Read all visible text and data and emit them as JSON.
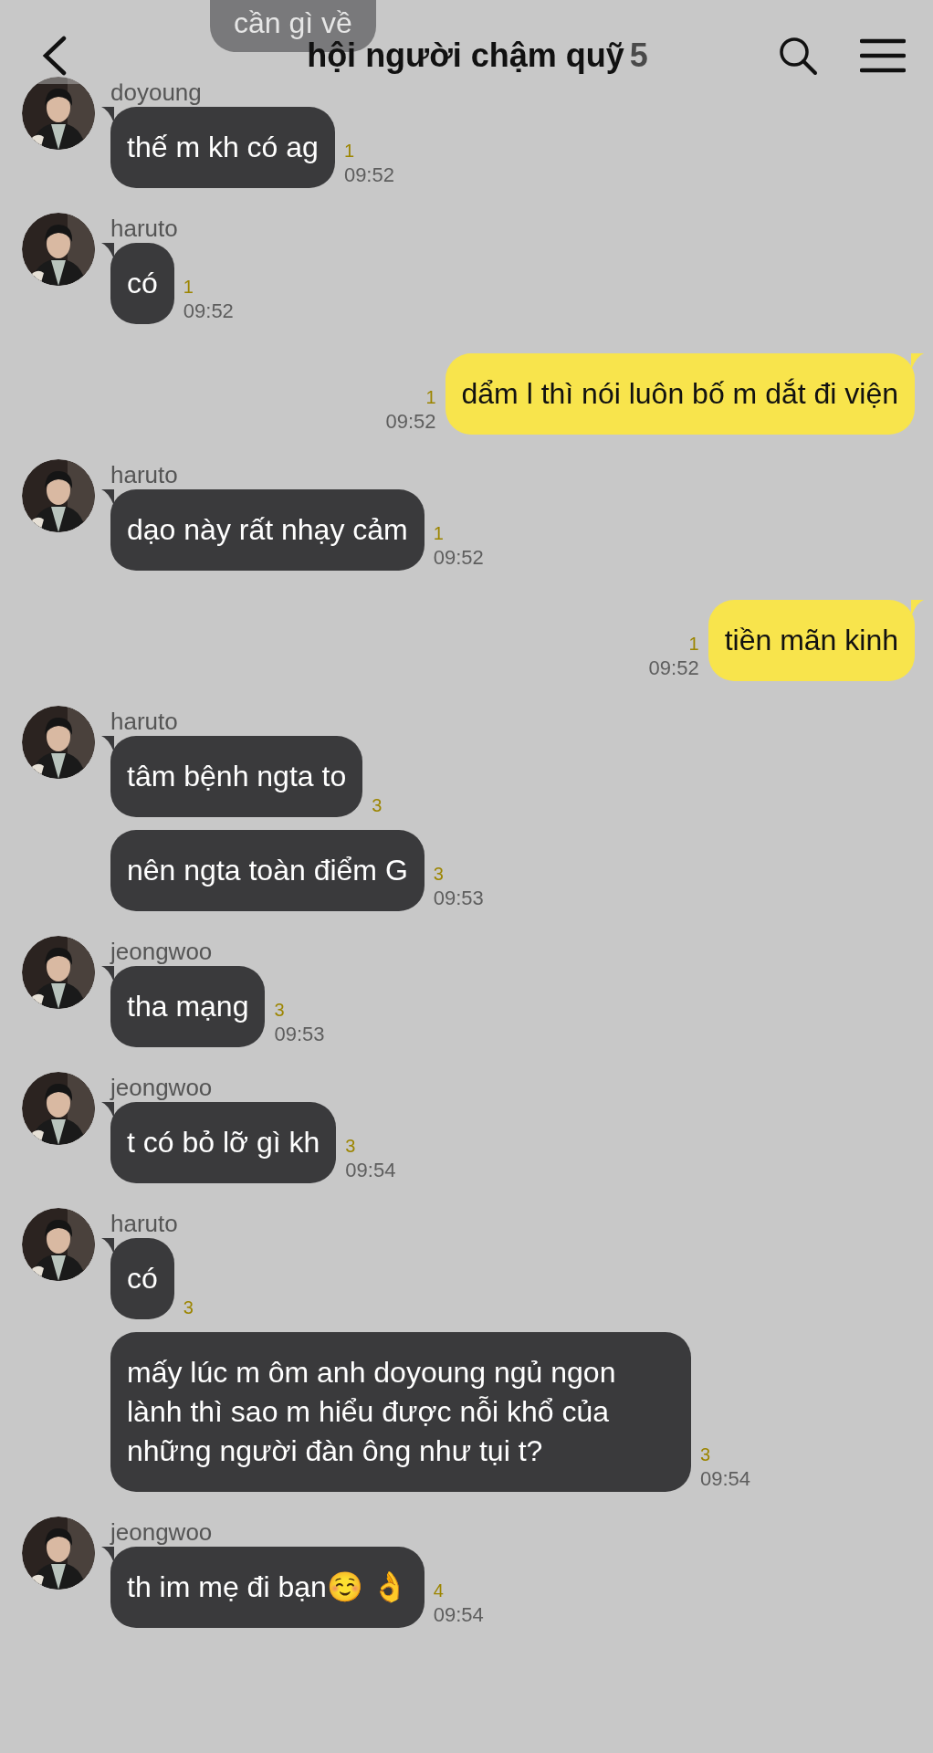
{
  "header": {
    "title": "hội người chậm quỹ",
    "member_count": "5"
  },
  "faded_message": {
    "text": "cần gì về"
  },
  "groups": [
    {
      "mine": false,
      "sender": "doyoung",
      "messages": [
        {
          "text": "thế m kh có ag",
          "unread": "1",
          "time": "09:52"
        }
      ]
    },
    {
      "mine": false,
      "sender": "haruto",
      "messages": [
        {
          "text": "có",
          "unread": "1",
          "time": "09:52"
        }
      ]
    },
    {
      "mine": true,
      "messages": [
        {
          "text": "dẩm l thì nói luôn bố m dắt đi viện",
          "unread": "1",
          "time": "09:52"
        }
      ]
    },
    {
      "mine": false,
      "sender": "haruto",
      "messages": [
        {
          "text": "dạo này rất nhạy cảm",
          "unread": "1",
          "time": "09:52"
        }
      ]
    },
    {
      "mine": true,
      "messages": [
        {
          "text": "tiền mãn kinh",
          "unread": "1",
          "time": "09:52"
        }
      ]
    },
    {
      "mine": false,
      "sender": "haruto",
      "messages": [
        {
          "text": "tâm bệnh ngta to",
          "unread": "3"
        },
        {
          "text": "nên ngta toàn điểm G",
          "unread": "3",
          "time": "09:53"
        }
      ]
    },
    {
      "mine": false,
      "sender": "jeongwoo",
      "messages": [
        {
          "text": "tha mạng",
          "unread": "3",
          "time": "09:53"
        }
      ]
    },
    {
      "mine": false,
      "sender": "jeongwoo",
      "messages": [
        {
          "text": "t có bỏ lỡ gì kh",
          "unread": "3",
          "time": "09:54"
        }
      ]
    },
    {
      "mine": false,
      "sender": "haruto",
      "messages": [
        {
          "text": "có",
          "unread": "3"
        },
        {
          "text": "mấy lúc m ôm anh doyoung ngủ ngon lành thì sao m hiểu được nỗi khổ của những người đàn ông như tụi t?",
          "unread": "3",
          "time": "09:54"
        }
      ]
    },
    {
      "mine": false,
      "sender": "jeongwoo",
      "messages": [
        {
          "text": "th im mẹ đi bạn☺️ 👌",
          "unread": "4",
          "time": "09:54"
        }
      ]
    }
  ]
}
